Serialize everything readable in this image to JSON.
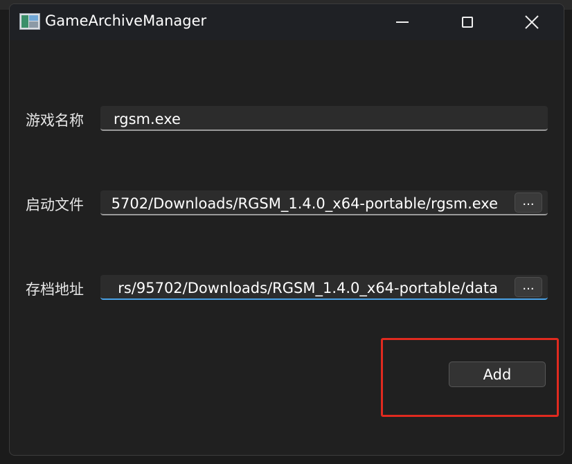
{
  "window": {
    "title": "GameArchiveManager"
  },
  "controls": {
    "minimize_icon": "minimize-icon",
    "maximize_icon": "maximize-icon",
    "close_icon": "close-icon"
  },
  "form": {
    "game_name": {
      "label": "游戏名称",
      "value": "rgsm.exe"
    },
    "launch_file": {
      "label": "启动文件",
      "value": "5702/Downloads/RGSM_1.4.0_x64-portable/rgsm.exe",
      "browse_label": "..."
    },
    "save_path": {
      "label": "存档地址",
      "value": "rs/95702/Downloads/RGSM_1.4.0_x64-portable/data",
      "browse_label": "..."
    }
  },
  "actions": {
    "add_label": "Add"
  },
  "colors": {
    "accent_focus": "#4aa3e8",
    "highlight": "#e02a1f"
  }
}
